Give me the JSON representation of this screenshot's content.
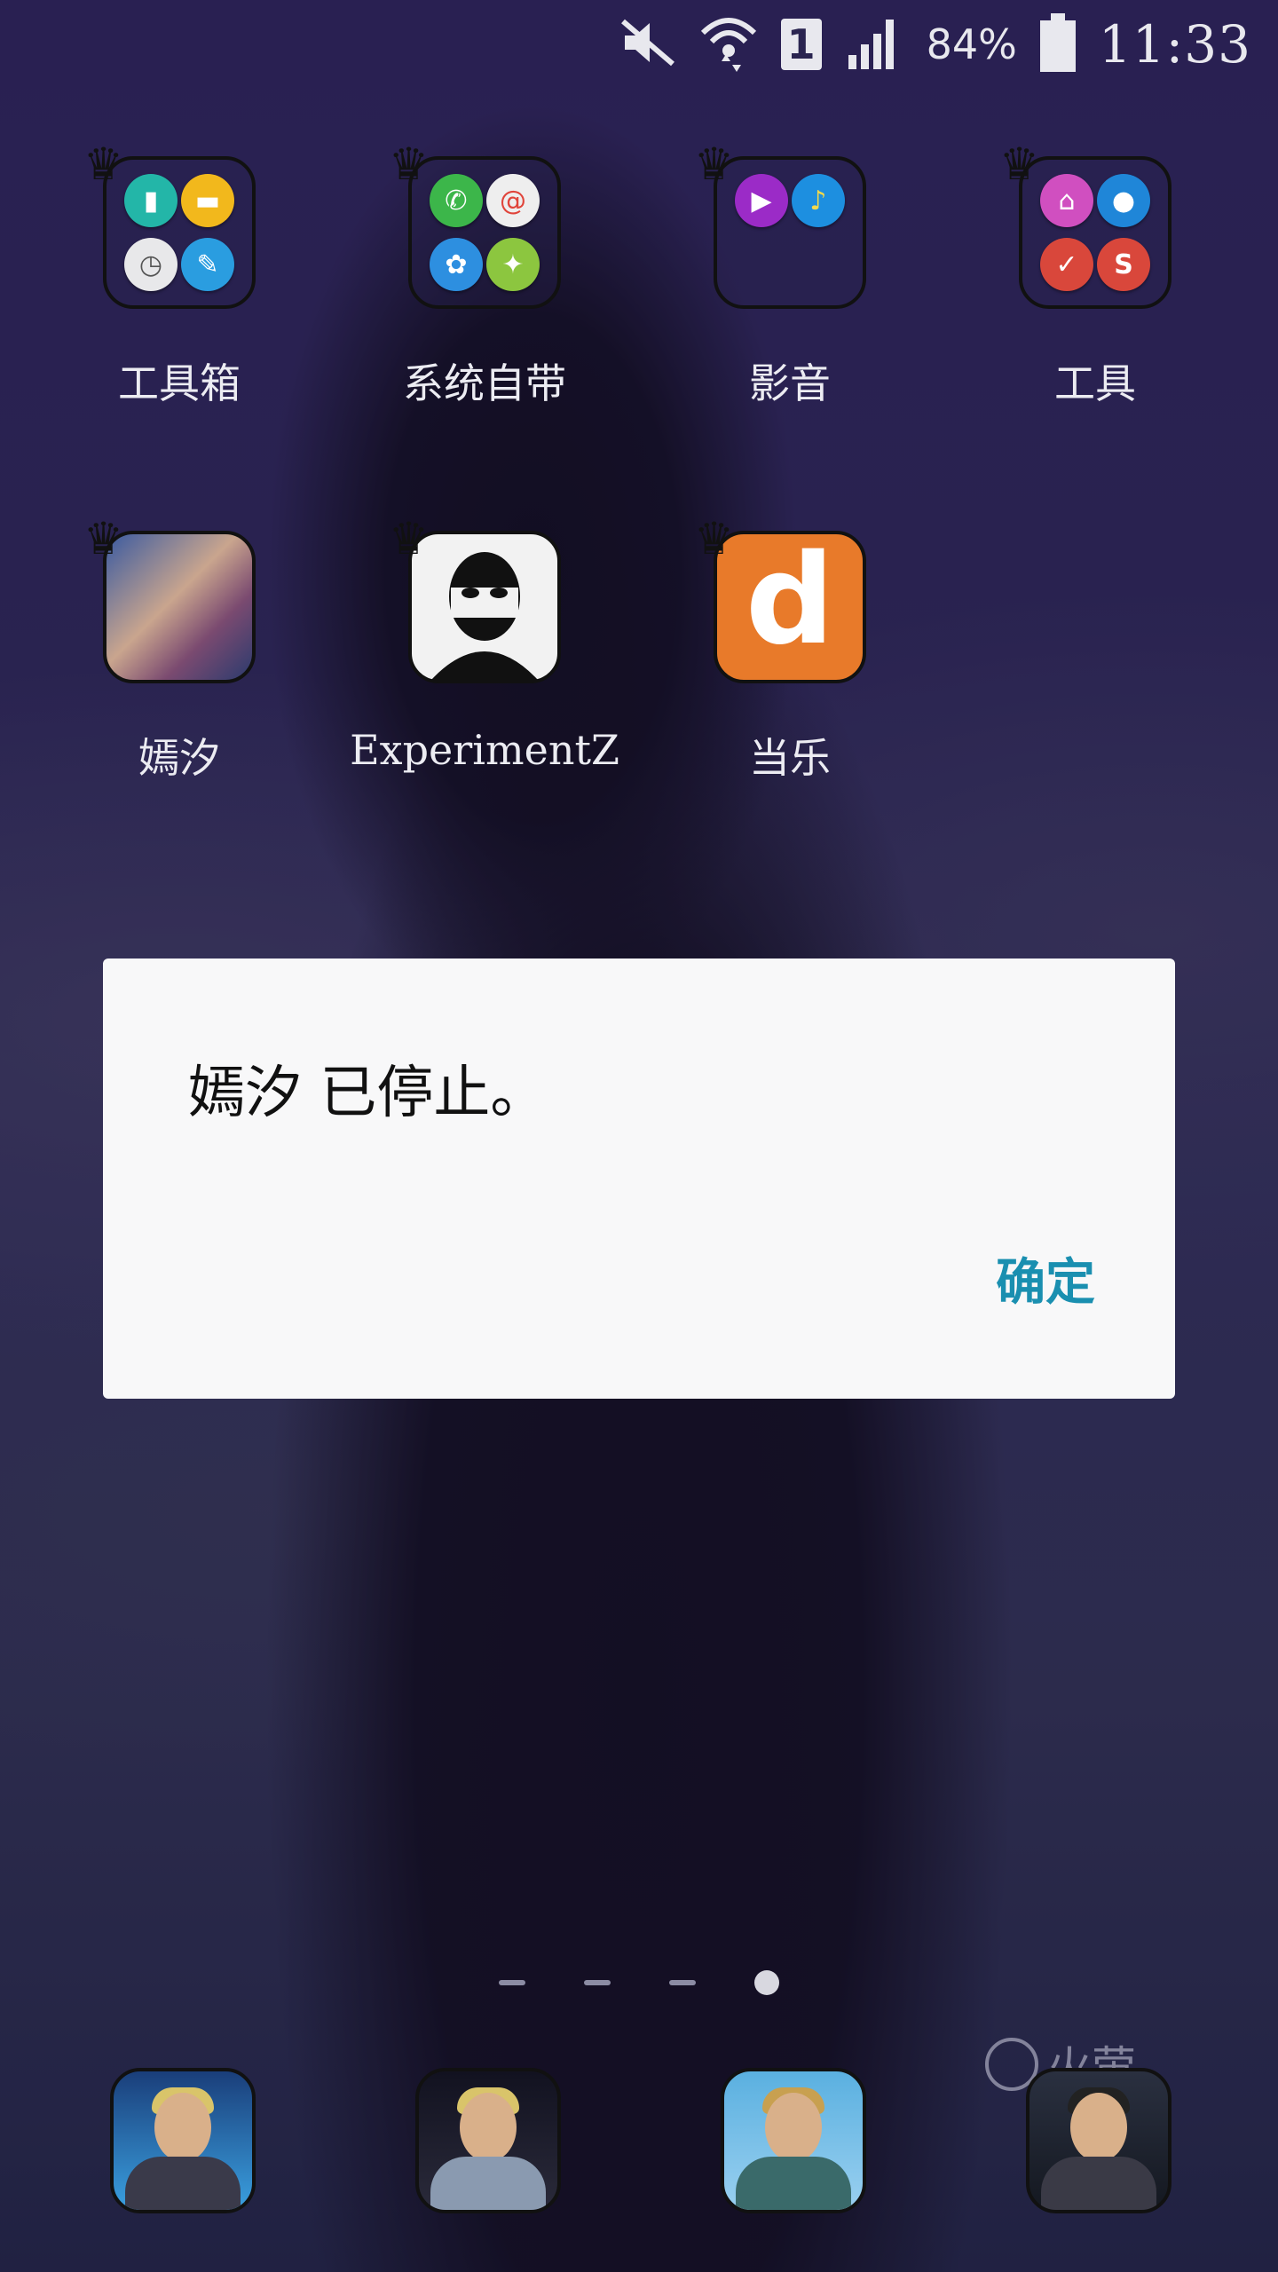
{
  "status_bar": {
    "battery_text": "84%",
    "time": "11:33",
    "sim_slot": "1",
    "icons": [
      "mute-icon",
      "wifi-icon",
      "sim-icon",
      "signal-icon",
      "battery-icon"
    ]
  },
  "home": {
    "row1": [
      {
        "label": "工具箱",
        "type": "folder"
      },
      {
        "label": "系统自带",
        "type": "folder"
      },
      {
        "label": "影音",
        "type": "folder"
      },
      {
        "label": "工具",
        "type": "folder"
      }
    ],
    "row2": [
      {
        "label": "嫣汐",
        "type": "app"
      },
      {
        "label": "ExperimentZ",
        "type": "app"
      },
      {
        "label": "当乐",
        "type": "app"
      }
    ],
    "dangle_letter": "d"
  },
  "dialog": {
    "message": "嫣汐 已停止。",
    "ok_label": "确定",
    "accent_color": "#1a8fb0"
  },
  "pager": {
    "pages": 4,
    "current": 4
  },
  "watermark": {
    "text": "火萤"
  }
}
